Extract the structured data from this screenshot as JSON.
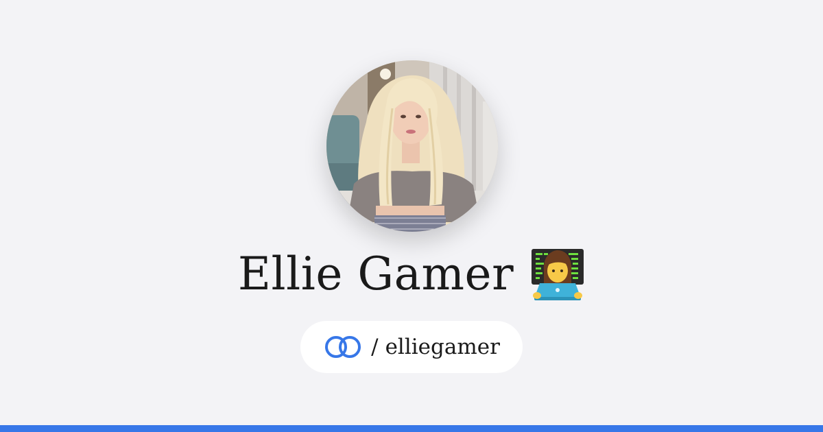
{
  "profile": {
    "display_name": "Ellie Gamer",
    "name_emoji": "woman-technologist-emoji",
    "separator": "/",
    "username": "elliegamer",
    "avatar": "profile-photo"
  },
  "icons": {
    "brand": "linked-rings-icon",
    "emoji": "woman-technologist-icon"
  },
  "colors": {
    "background": "#f3f3f6",
    "accent": "#3777e8",
    "text": "#1a1a1a",
    "pill": "#ffffff"
  }
}
